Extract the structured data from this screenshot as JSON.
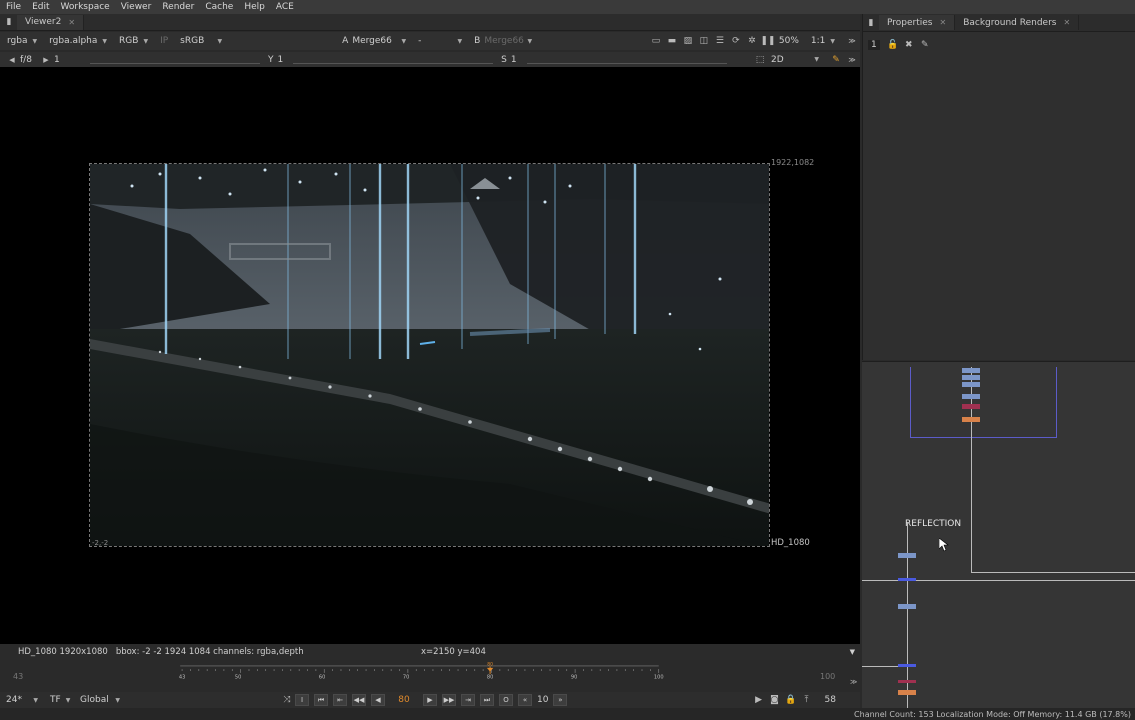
{
  "menu": [
    "File",
    "Edit",
    "Workspace",
    "Viewer",
    "Render",
    "Cache",
    "Help",
    "ACE"
  ],
  "viewer_tab": "Viewer2",
  "right_tabs": [
    "Properties",
    "Background Renders"
  ],
  "toolbar": {
    "channels": "rgba",
    "alpha": "rgba.alpha",
    "display": "RGB",
    "ip": "IP",
    "colorspace": "sRGB",
    "a_label": "A",
    "a_input": "Merge66",
    "a_op": "-",
    "b_label": "B",
    "b_input": "Merge66",
    "zoom": "50%",
    "ratio": "1:1"
  },
  "toolbar2": {
    "fstop": "f/8",
    "frame_val": "1",
    "y_label": "Y",
    "y_val": "1",
    "s_label": "S",
    "s_val": "1",
    "mode": "2D"
  },
  "properties_number": "1",
  "viewer": {
    "top_right_coord": "1922,1082",
    "bottom_left_coord": "-2,-2",
    "format_label": "HD_1080"
  },
  "info": {
    "format": "HD_1080 1920x1080",
    "bbox": "bbox: -2 -2 1924 1084 channels: rgba,depth",
    "coords": "x=2150 y=404"
  },
  "timeline": {
    "start": "43",
    "end": "100",
    "current": "80",
    "ticks": [
      "43",
      "50",
      "60",
      "70",
      "80",
      "90",
      "100"
    ]
  },
  "transport": {
    "fps": "24*",
    "tf": "TF",
    "scope": "Global",
    "frame": "80",
    "step": "10",
    "end_frame": "58"
  },
  "node_graph": {
    "reflection_label": "REFLECTION"
  },
  "status": "Channel Count: 153  Localization Mode: Off  Memory: 11.4 GB (17.8%)"
}
